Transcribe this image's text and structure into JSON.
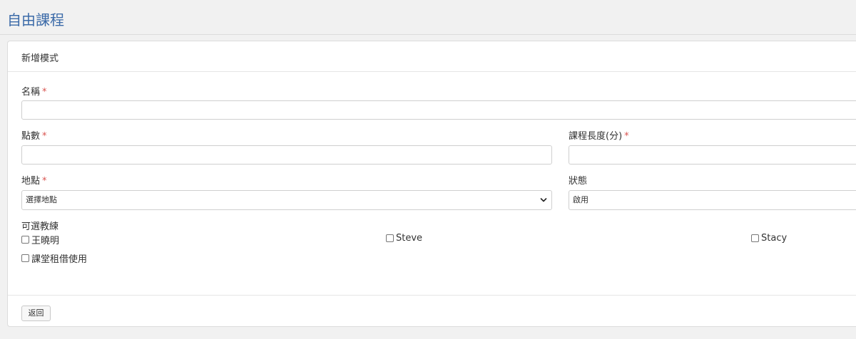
{
  "page": {
    "title": "自由課程"
  },
  "card": {
    "mode_label": "新增模式"
  },
  "form": {
    "name": {
      "label": "名稱",
      "required_mark": "*",
      "value": ""
    },
    "points": {
      "label": "點數",
      "required_mark": "*",
      "value": ""
    },
    "duration": {
      "label": "課程長度(分)",
      "required_mark": "*",
      "value": ""
    },
    "location": {
      "label": "地點",
      "required_mark": "*",
      "selected": "選擇地點"
    },
    "status": {
      "label": "狀態",
      "selected": "啟用"
    },
    "coaches": {
      "label": "可選教練",
      "options": [
        {
          "label": "王曉明",
          "checked": false
        },
        {
          "label": "Steve",
          "checked": false
        },
        {
          "label": "Stacy",
          "checked": false
        }
      ]
    },
    "rental": {
      "label": "課堂租借使用",
      "checked": false
    }
  },
  "footer": {
    "back_label": "返回"
  },
  "icons": {
    "select_arrow": "chevron-down-icon"
  }
}
